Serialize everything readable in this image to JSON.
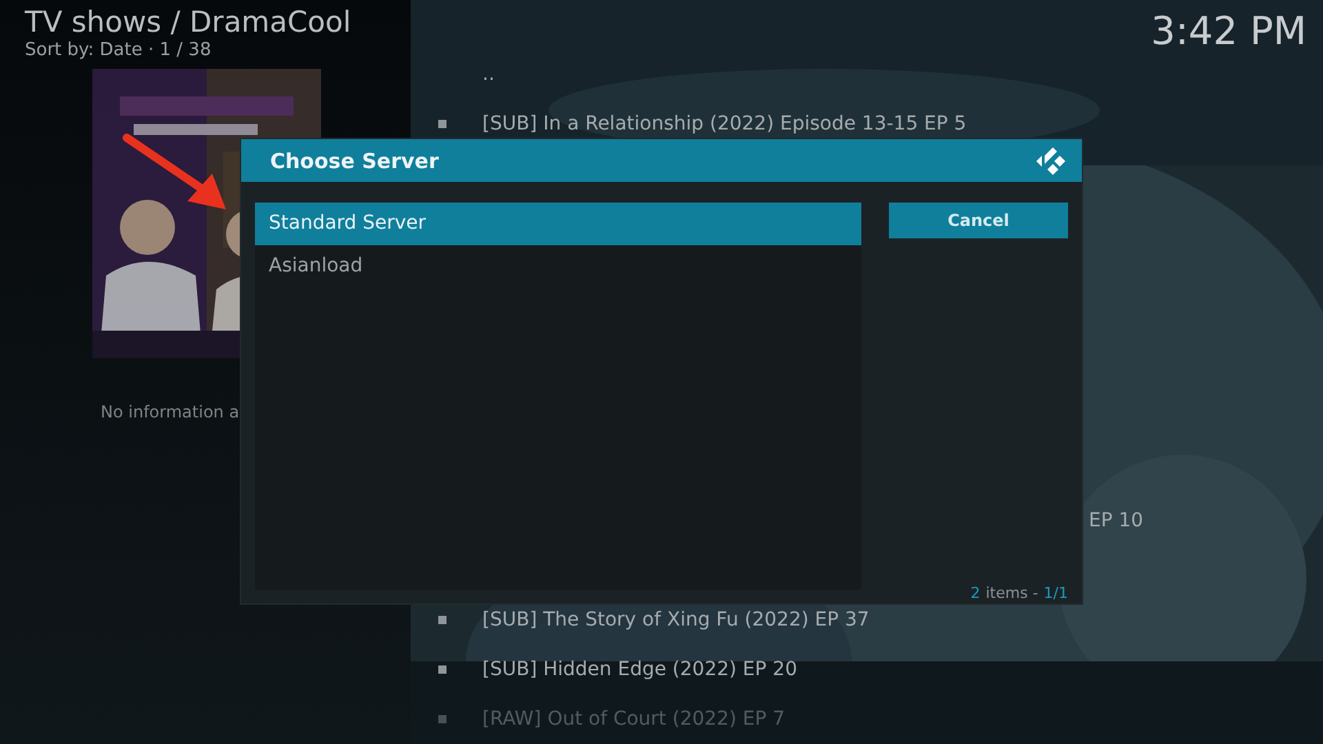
{
  "header": {
    "breadcrumb": "TV shows / DramaCool",
    "sort": "Sort by: Date · 1 / 38",
    "clock": "3:42 PM"
  },
  "info": {
    "text": "No information a"
  },
  "episodes": [
    {
      "kind": "parent",
      "label": ".."
    },
    {
      "kind": "full",
      "label": "[SUB] In a Relationship (2022) Episode 13-15 EP 5"
    },
    {
      "kind": "partial",
      "label": "EP 10"
    },
    {
      "kind": "full",
      "label": "[SUB] The Story of Xing Fu (2022) EP 37"
    },
    {
      "kind": "full",
      "label": "[SUB] Hidden Edge (2022) EP 20"
    },
    {
      "kind": "full",
      "label": "[RAW] Out of Court (2022) EP 7"
    }
  ],
  "dialog": {
    "title": "Choose Server",
    "options": [
      {
        "label": "Standard Server",
        "selected": true
      },
      {
        "label": "Asianload",
        "selected": false
      }
    ],
    "cancel": "Cancel",
    "footer": {
      "count": "2",
      "label": "items -",
      "page": "1/1"
    }
  }
}
